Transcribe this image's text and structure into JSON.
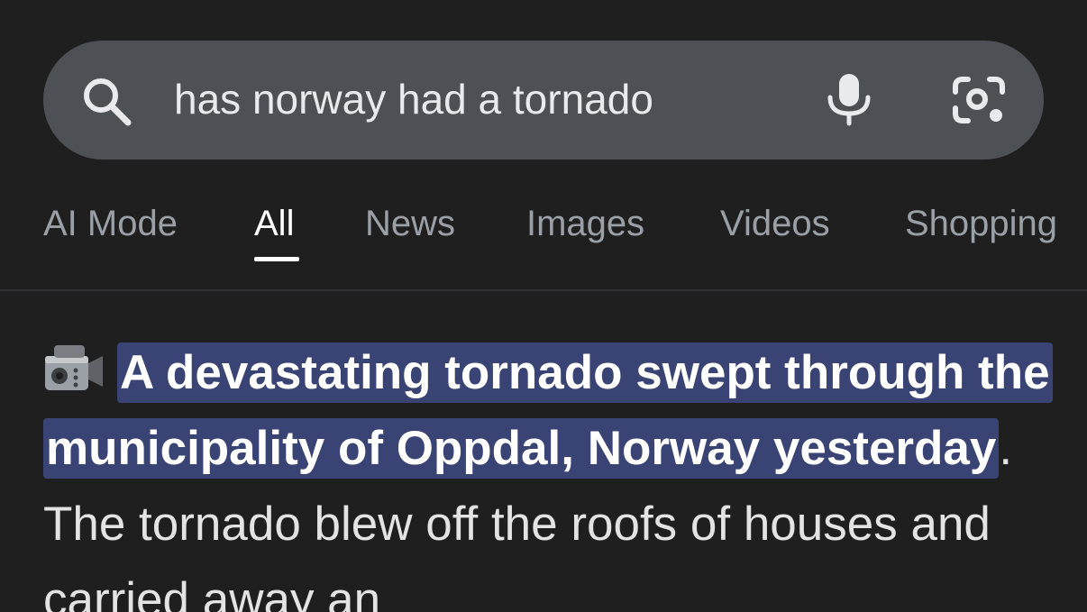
{
  "search": {
    "query": "has norway had a tornado",
    "icons": {
      "search": "search-icon",
      "mic": "microphone-icon",
      "lens": "google-lens-icon"
    }
  },
  "tabs": {
    "items": [
      {
        "label": "AI Mode"
      },
      {
        "label": "All",
        "active": true
      },
      {
        "label": "News"
      },
      {
        "label": "Images"
      },
      {
        "label": "Videos"
      },
      {
        "label": "Shopping"
      }
    ]
  },
  "result": {
    "emoji": "video-camera-icon",
    "highlighted": "A devastating tornado swept through the municipality of Oppdal, Norway yesterday",
    "rest": ". The tornado blew off the roofs of houses and carried away an"
  },
  "colors": {
    "background": "#1f1f1f",
    "search_bar": "#4d5156",
    "highlight": "#394374",
    "active_tab": "#ffffff",
    "inactive_tab": "#9aa0a6"
  }
}
